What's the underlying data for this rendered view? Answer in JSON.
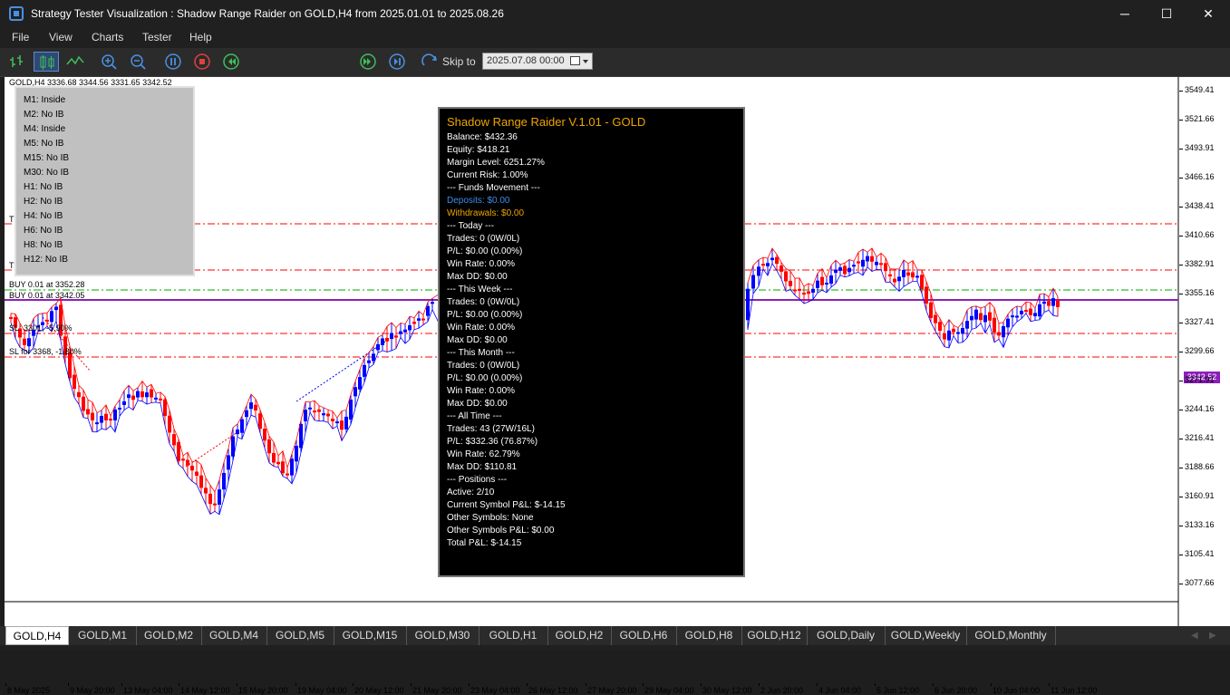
{
  "window": {
    "title": "Strategy Tester Visualization : Shadow Range Raider on GOLD,H4 from 2025.01.01 to 2025.08.26",
    "min_glyph": "─",
    "max_glyph": "☐",
    "close_glyph": "✕"
  },
  "menu": [
    "File",
    "View",
    "Charts",
    "Tester",
    "Help"
  ],
  "toolbar": {
    "skip_to_label": "Skip to",
    "skip_to_value": "2025.07.08 00:00",
    "speed_fraction": 0.37,
    "icons": [
      "bar-chart-icon",
      "candlestick-icon",
      "line-chart-icon",
      "zoom-in-icon",
      "zoom-out-icon",
      "pause-icon",
      "stop-icon",
      "step-back-icon",
      "step-forward-icon",
      "skip-forward-icon",
      "skip-to-icon"
    ]
  },
  "chart": {
    "ohlc_header": "GOLD,H4  3336.68 3344.56 3331.65 3342.52",
    "current_price": "3342.52",
    "y_ticks": [
      "3549.41",
      "3521.66",
      "3493.91",
      "3466.16",
      "3438.41",
      "3410.66",
      "3382.91",
      "3355.16",
      "3327.41",
      "3299.66",
      "3271.91",
      "3244.16",
      "3216.41",
      "3188.66",
      "3160.91",
      "3133.16",
      "3105.41",
      "3077.66"
    ],
    "x_ticks": [
      "8 May 2025",
      "9 May 20:00",
      "13 May 04:00",
      "14 May 12:00",
      "15 May 20:00",
      "19 May 04:00",
      "20 May 12:00",
      "21 May 20:00",
      "23 May 04:00",
      "26 May 12:00",
      "27 May 20:00",
      "29 May 04:00",
      "30 May 12:00",
      "2 Jun 20:00",
      "4 Jun 04:00",
      "5 Jun 12:00",
      "6 Jun 20:00",
      "10 Jun 04:00",
      "11 Jun 12:00"
    ],
    "colors": {
      "bull": "#0000ff",
      "bear": "#ff0000",
      "price_line": "#8b20b8",
      "sl_line": "#ff0000",
      "tp_line": "#00aa00"
    },
    "position_labels": [
      {
        "id": "t1",
        "text": "T"
      },
      {
        "id": "t2",
        "text": "T"
      },
      {
        "id": "buy1",
        "text": "BUY 0.01 at 3352.28"
      },
      {
        "id": "buy2",
        "text": "BUY 0.01 at 3342.05"
      },
      {
        "id": "sl1",
        "text": "SL: 3301, -5.90%"
      },
      {
        "id": "sl2",
        "text": "SL for 3368, -1.80%"
      }
    ]
  },
  "timeframe_status": [
    {
      "label": "M1: Inside"
    },
    {
      "label": "M2: No IB"
    },
    {
      "label": "M4: Inside"
    },
    {
      "label": "M5: No IB"
    },
    {
      "label": "M15: No IB"
    },
    {
      "label": "M30: No IB"
    },
    {
      "label": "H1: No IB"
    },
    {
      "label": "H2: No IB"
    },
    {
      "label": "H4: No IB"
    },
    {
      "label": "H6: No IB"
    },
    {
      "label": "H8: No IB"
    },
    {
      "label": "H12: No IB"
    }
  ],
  "info_panel": {
    "title": "Shadow Range Raider V.1.01 - GOLD",
    "lines": [
      {
        "text": "Balance: $432.36",
        "color": "#ffffff"
      },
      {
        "text": "Equity: $418.21",
        "color": "#ffffff"
      },
      {
        "text": "Margin Level: 6251.27%",
        "color": "#ffffff"
      },
      {
        "text": "Current Risk: 1.00%",
        "color": "#ffffff"
      },
      {
        "text": "--- Funds Movement ---",
        "color": "#ffffff"
      },
      {
        "text": "Deposits: $0.00",
        "color": "#3b8eea"
      },
      {
        "text": "Withdrawals: $0.00",
        "color": "#f0a500"
      },
      {
        "text": "--- Today ---",
        "color": "#ffffff"
      },
      {
        "text": "Trades: 0 (0W/0L)",
        "color": "#ffffff"
      },
      {
        "text": "P/L: $0.00 (0.00%)",
        "color": "#ffffff"
      },
      {
        "text": "Win Rate: 0.00%",
        "color": "#ffffff"
      },
      {
        "text": "Max DD: $0.00",
        "color": "#ffffff"
      },
      {
        "text": "--- This Week ---",
        "color": "#ffffff"
      },
      {
        "text": "Trades: 0 (0W/0L)",
        "color": "#ffffff"
      },
      {
        "text": "P/L: $0.00 (0.00%)",
        "color": "#ffffff"
      },
      {
        "text": "Win Rate: 0.00%",
        "color": "#ffffff"
      },
      {
        "text": "Max DD: $0.00",
        "color": "#ffffff"
      },
      {
        "text": "--- This Month ---",
        "color": "#ffffff"
      },
      {
        "text": "Trades: 0 (0W/0L)",
        "color": "#ffffff"
      },
      {
        "text": "P/L: $0.00 (0.00%)",
        "color": "#ffffff"
      },
      {
        "text": "Win Rate: 0.00%",
        "color": "#ffffff"
      },
      {
        "text": "Max DD: $0.00",
        "color": "#ffffff"
      },
      {
        "text": "--- All Time ---",
        "color": "#ffffff"
      },
      {
        "text": "Trades: 43 (27W/16L)",
        "color": "#ffffff"
      },
      {
        "text": "P/L: $332.36 (76.87%)",
        "color": "#ffffff"
      },
      {
        "text": "Win Rate: 62.79%",
        "color": "#ffffff"
      },
      {
        "text": "Max DD: $110.81",
        "color": "#ffffff"
      },
      {
        "text": "--- Positions ---",
        "color": "#ffffff"
      },
      {
        "text": "Active: 2/10",
        "color": "#ffffff"
      },
      {
        "text": "Current Symbol P&L: $-14.15",
        "color": "#ffffff"
      },
      {
        "text": "Other Symbols: None",
        "color": "#ffffff"
      },
      {
        "text": "Other Symbols P&L: $0.00",
        "color": "#ffffff"
      },
      {
        "text": "Total P&L: $-14.15",
        "color": "#ffffff"
      }
    ]
  },
  "tabs": [
    "GOLD,H4",
    "GOLD,M1",
    "GOLD,M2",
    "GOLD,M4",
    "GOLD,M5",
    "GOLD,M15",
    "GOLD,M30",
    "GOLD,H1",
    "GOLD,H2",
    "GOLD,H6",
    "GOLD,H8",
    "GOLD,H12",
    "GOLD,Daily",
    "GOLD,Weekly",
    "GOLD,Monthly"
  ],
  "active_tab": "GOLD,H4"
}
